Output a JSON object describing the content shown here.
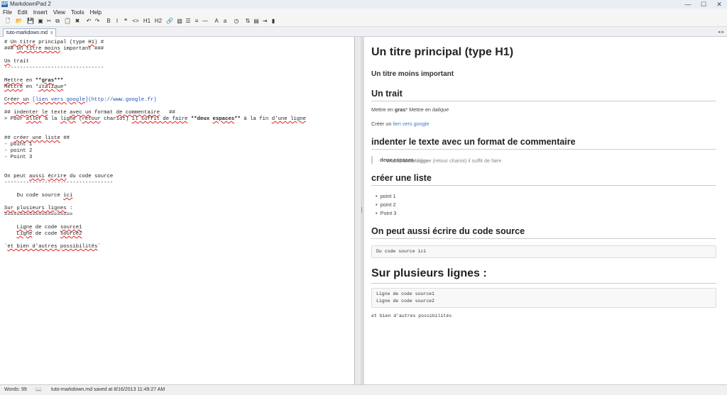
{
  "window": {
    "title": "MarkdownPad 2",
    "min": "—",
    "max": "☐",
    "close": "✕",
    "app_icon": "MP"
  },
  "menu": [
    "File",
    "Edit",
    "Insert",
    "View",
    "Tools",
    "Help"
  ],
  "toolbar": {
    "buttons": [
      {
        "icon": "new-file-icon",
        "glyph": "🗋"
      },
      {
        "icon": "open-folder-icon",
        "glyph": "📂"
      },
      {
        "icon": "save-icon",
        "glyph": "💾"
      },
      {
        "icon": "save-all-icon",
        "glyph": "▣"
      },
      {
        "icon": "cut-icon",
        "glyph": "✂"
      },
      {
        "icon": "copy-icon",
        "glyph": "⧉"
      },
      {
        "icon": "paste-icon",
        "glyph": "📋"
      },
      {
        "icon": "delete-icon",
        "glyph": "✖"
      },
      {
        "icon": "undo-icon",
        "glyph": "↶"
      },
      {
        "icon": "redo-icon",
        "glyph": "↷"
      },
      {
        "icon": "bold-icon",
        "glyph": "B"
      },
      {
        "icon": "italic-icon",
        "glyph": "I"
      },
      {
        "icon": "quote-icon",
        "glyph": "❝"
      },
      {
        "icon": "code-icon",
        "glyph": "<>"
      },
      {
        "icon": "h1-icon",
        "glyph": "H1"
      },
      {
        "icon": "h2-icon",
        "glyph": "H2"
      },
      {
        "icon": "link-icon",
        "glyph": "🔗"
      },
      {
        "icon": "image-icon",
        "glyph": "▨"
      },
      {
        "icon": "bullet-list-icon",
        "glyph": "☰"
      },
      {
        "icon": "numbered-list-icon",
        "glyph": "≡"
      },
      {
        "icon": "horizontal-rule-icon",
        "glyph": "―"
      },
      {
        "icon": "uppercase-icon",
        "glyph": "A"
      },
      {
        "icon": "lowercase-icon",
        "glyph": "a"
      },
      {
        "icon": "timestamp-icon",
        "glyph": "◷"
      },
      {
        "icon": "sync-scroll-icon",
        "glyph": "⇅"
      },
      {
        "icon": "preview-icon",
        "glyph": "▤"
      },
      {
        "icon": "export-icon",
        "glyph": "⇥"
      },
      {
        "icon": "toggle-icon",
        "glyph": "▮"
      }
    ]
  },
  "tab": {
    "name": "tuto-markdown.md",
    "close": "x"
  },
  "tab_nav": "◂ ▸",
  "editor": {
    "lines": [
      "# Un titre principal (type H1) #",
      "### Un titre moins important ###",
      "",
      "Un trait",
      "--------------------------------",
      "",
      "Mettre en **gras***",
      "Mettre en *italique*",
      "",
      "Créer un [lien vers google](http://www.google.fr)",
      "",
      "## indenter le texte avec un format de commentaire   ##",
      "> Pour aller à la ligne (retour chariot) il suffit de faire **deux espaces** à la fin d'une ligne",
      "",
      "",
      "## créer une liste ##",
      "- point 1",
      "- point 2",
      "- Point 3",
      "",
      "",
      "On peut aussi écrire du code source",
      "-----------------------------------",
      "",
      "    Du code source ici",
      "",
      "Sur plusieurs lignes :",
      "======================",
      "",
      "    Ligne de code source1",
      "    Ligne de code source2",
      "",
      "`et bien d'autres possibilités`"
    ]
  },
  "preview": {
    "h1": "Un titre principal (type H1)",
    "h3": "Un titre moins important",
    "h2_trait": "Un trait",
    "gras_before": "Mettre en ",
    "gras_bold": "gras",
    "gras_after": "* Mettre en ",
    "italique": "italique",
    "link_before": "Créer un ",
    "link_text": "lien vers google",
    "h2_indent": "indenter le texte avec un format de commentaire",
    "quote_before": "Pour aller à la ligne (retour chariot) il suffit de faire ",
    "quote_bold": "deux espaces",
    "quote_after": " à la fin d'une ligne",
    "h2_liste": "créer une liste",
    "list": [
      "point 1",
      "point 2",
      "Point 3"
    ],
    "h2_code": "On peut aussi écrire du code source",
    "code1": "Du code source ici",
    "h1_multi": "Sur plusieurs lignes :",
    "code2": [
      "Ligne de code source1",
      "Ligne de code source2"
    ],
    "inline_code": "et bien d'autres possibilités"
  },
  "status": {
    "words": "Words: 99",
    "saved": "tuto-markdown.md saved at 8/16/2013 11:49:27 AM"
  }
}
